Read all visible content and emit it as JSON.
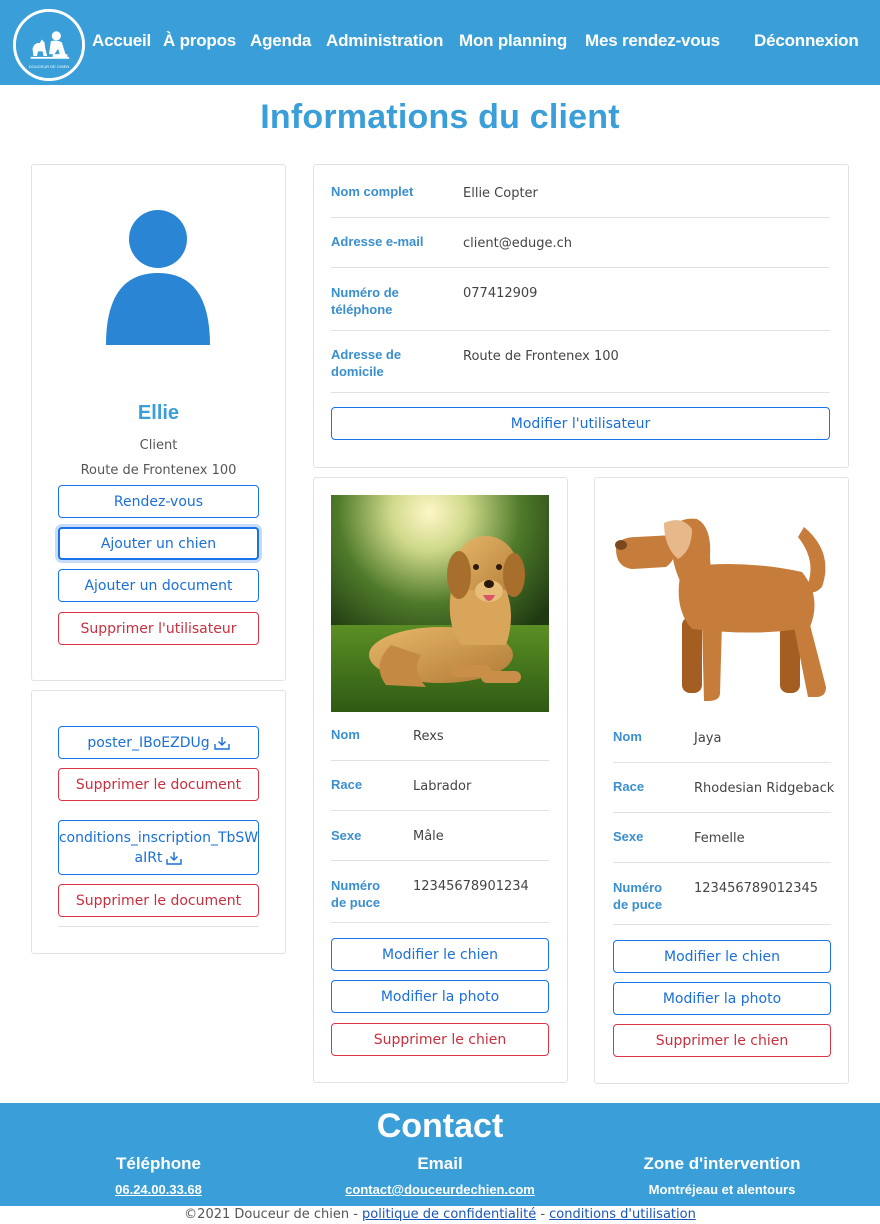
{
  "nav": {
    "logo_text": "DOUCEUR DE CHIEN",
    "links": [
      "Accueil",
      "À propos",
      "Agenda",
      "Administration",
      "Mon planning",
      "Mes rendez-vous"
    ],
    "logout": "Déconnexion"
  },
  "page": {
    "title": "Informations du client"
  },
  "profile": {
    "name": "Ellie",
    "role": "Client",
    "address": "Route de Frontenex 100",
    "buttons": {
      "appointments": "Rendez-vous",
      "add_dog": "Ajouter un chien",
      "add_document": "Ajouter un document",
      "delete_user": "Supprimer l'utilisateur"
    }
  },
  "documents": [
    {
      "name": "poster_IBoEZDUg",
      "delete_label": "Supprimer le document"
    },
    {
      "name_line1": "conditions_inscription_TbSW",
      "name_line2": "aIRt",
      "delete_label": "Supprimer le document"
    }
  ],
  "user_info": {
    "fields": [
      {
        "label": "Nom complet",
        "value": "Ellie Copter"
      },
      {
        "label": "Adresse e-mail",
        "value": "client@eduge.ch"
      },
      {
        "label_line1": "Numéro de",
        "label_line2": "téléphone",
        "value": "077412909"
      },
      {
        "label_line1": "Adresse de",
        "label_line2": "domicile",
        "value": "Route de Frontenex 100"
      }
    ],
    "edit_button": "Modifier l'utilisateur"
  },
  "dogs": [
    {
      "name_label": "Nom",
      "name": "Rexs",
      "breed_label": "Race",
      "breed": "Labrador",
      "sex_label": "Sexe",
      "sex": "Mâle",
      "chip_label_line1": "Numéro",
      "chip_label_line2": "de puce",
      "chip": "12345678901234",
      "edit": "Modifier le chien",
      "edit_photo": "Modifier la photo",
      "delete": "Supprimer le chien"
    },
    {
      "name_label": "Nom",
      "name": "Jaya",
      "breed_label": "Race",
      "breed": "Rhodesian Ridgeback",
      "sex_label": "Sexe",
      "sex": "Femelle",
      "chip_label_line1": "Numéro",
      "chip_label_line2": "de puce",
      "chip": "123456789012345",
      "edit": "Modifier le chien",
      "edit_photo": "Modifier la photo",
      "delete": "Supprimer le chien"
    }
  ],
  "footer": {
    "title": "Contact",
    "phone_head": "Téléphone",
    "phone": "06.24.00.33.68",
    "email_head": "Email",
    "email": "contact@douceurdechien.com",
    "zone_head": "Zone d'intervention",
    "zone": "Montréjeau et alentours"
  },
  "copyright": {
    "text": "©2021 Douceur de chien - ",
    "privacy": "politique de confidentialité",
    "sep": " - ",
    "terms": "conditions d'utilisation"
  },
  "colors": {
    "brand": "#3a9fd8",
    "primary": "#1a73e8",
    "danger": "#dc3545",
    "avatar": "#2a86d4",
    "dog_illustration": "#c67c3a"
  },
  "icons": {
    "download": "download-icon",
    "avatar": "user-avatar-icon",
    "logo": "dog-logo-icon"
  }
}
